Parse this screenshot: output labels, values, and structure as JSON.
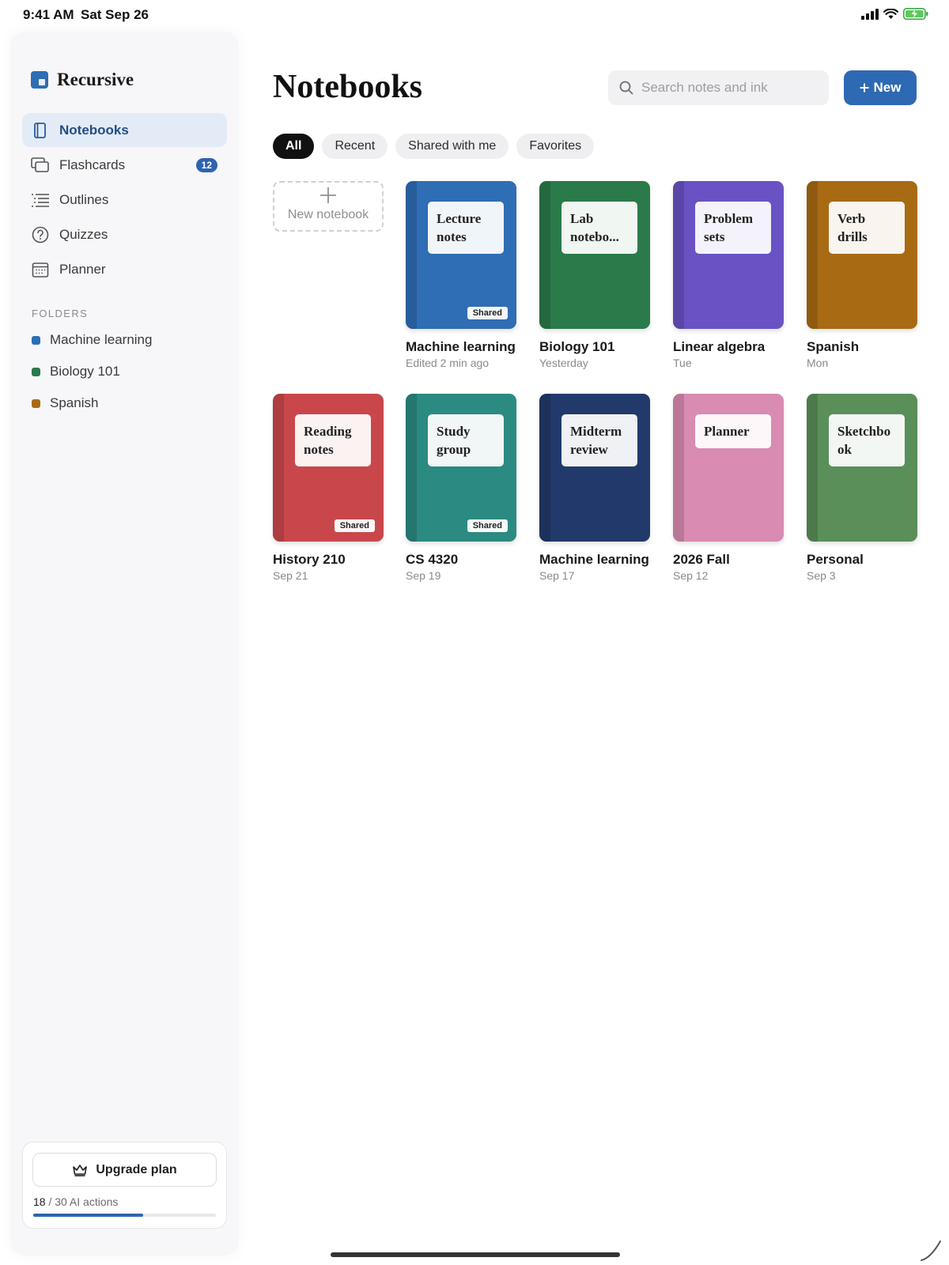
{
  "status": {
    "time": "9:41 AM",
    "date": "Sat Sep 26"
  },
  "brand": {
    "name": "Recursive"
  },
  "nav": [
    {
      "label": "Notebooks",
      "icon": "notebook-icon",
      "active": true
    },
    {
      "label": "Flashcards",
      "icon": "flashcards-icon",
      "badge": "12"
    },
    {
      "label": "Outlines",
      "icon": "outline-icon"
    },
    {
      "label": "Quizzes",
      "icon": "question-icon"
    },
    {
      "label": "Planner",
      "icon": "calendar-icon"
    }
  ],
  "folders": {
    "title": "FOLDERS",
    "items": [
      {
        "label": "Machine learning",
        "color": "#2f6db5"
      },
      {
        "label": "Biology 101",
        "color": "#2b7a4a"
      },
      {
        "label": "Spanish",
        "color": "#a86b14"
      }
    ]
  },
  "upgrade": {
    "label": "Upgrade plan",
    "used": "18",
    "usage_rest": " / 30 AI actions",
    "fraction": 0.6
  },
  "main": {
    "title": "Notebooks",
    "search_placeholder": "Search notes and ink",
    "new_label": "New",
    "filters": [
      "All",
      "Recent",
      "Shared with me",
      "Favorites"
    ],
    "new_notebook_label": "New notebook",
    "shared_tag": "Shared",
    "notebooks": [
      {
        "cover_label": "Lecture notes",
        "name": "Machine learning",
        "date": "Edited 2 min ago",
        "color": "#2f6db5",
        "shared": true
      },
      {
        "cover_label": "Lab notebo...",
        "name": "Biology 101",
        "date": "Yesterday",
        "color": "#2b7a4a",
        "shared": false
      },
      {
        "cover_label": "Problem sets",
        "name": "Linear algebra",
        "date": "Tue",
        "color": "#6a52c4",
        "shared": false
      },
      {
        "cover_label": "Verb drills",
        "name": "Spanish",
        "date": "Mon",
        "color": "#a86b14",
        "shared": false
      },
      {
        "cover_label": "Reading notes",
        "name": "History 210",
        "date": "Sep 21",
        "color": "#c9474b",
        "shared": true
      },
      {
        "cover_label": "Study group",
        "name": "CS 4320",
        "date": "Sep 19",
        "color": "#2b8a82",
        "shared": true
      },
      {
        "cover_label": "Midterm review",
        "name": "Machine learning",
        "date": "Sep 17",
        "color": "#213a6b",
        "shared": false
      },
      {
        "cover_label": "Planner",
        "name": "2026 Fall",
        "date": "Sep 12",
        "color": "#d98bb2",
        "shared": false
      },
      {
        "cover_label": "Sketchbo ok",
        "name": "Personal",
        "date": "Sep 3",
        "color": "#5a8f59",
        "shared": false
      }
    ]
  }
}
